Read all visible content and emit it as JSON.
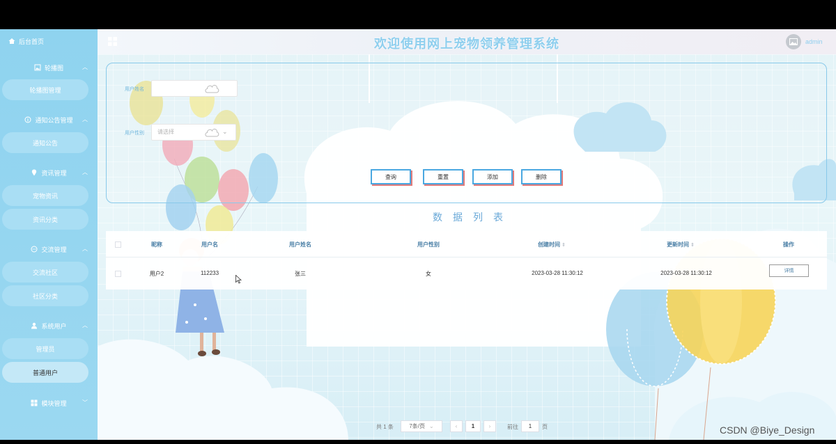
{
  "sidebar": {
    "home_label": "后台首页",
    "groups": [
      {
        "label": "轮播图",
        "items": [
          "轮播图管理"
        ]
      },
      {
        "label": "通知公告管理",
        "items": [
          "通知公告"
        ]
      },
      {
        "label": "资讯管理",
        "items": [
          "宠物资讯",
          "资讯分类"
        ]
      },
      {
        "label": "交流管理",
        "items": [
          "交流社区",
          "社区分类"
        ]
      },
      {
        "label": "系统用户",
        "items": [
          "管理员",
          "普通用户"
        ]
      },
      {
        "label": "模块管理",
        "items": []
      }
    ],
    "active_item": "普通用户"
  },
  "header": {
    "title": "欢迎使用网上宠物领养管理系统",
    "username": "admin"
  },
  "search": {
    "name_label": "用户姓名",
    "name_value": "",
    "gender_label": "用户性别",
    "gender_placeholder": "请选择",
    "buttons": [
      "查询",
      "重置",
      "添加",
      "删除"
    ]
  },
  "list_title": "数据列表",
  "table": {
    "columns": [
      "昵称",
      "用户名",
      "用户姓名",
      "用户性别",
      "创建时间",
      "更新时间",
      "操作"
    ],
    "rows": [
      {
        "nickname": "用户2",
        "username": "112233",
        "realname": "张三",
        "gender": "女",
        "created": "2023-03-28 11:30:12",
        "updated": "2023-03-28 11:30:12",
        "action": "详情"
      }
    ]
  },
  "pagination": {
    "total": "共 1 条",
    "page_size": "7条/页",
    "current_page": "1",
    "goto_label": "前往",
    "goto_value": "1",
    "page_suffix": "页"
  },
  "watermark": "CSDN @Biye_Design",
  "colors": {
    "sidebar": "#8fd3ef",
    "accent": "#4aa8e1",
    "title": "#8fcfee"
  }
}
